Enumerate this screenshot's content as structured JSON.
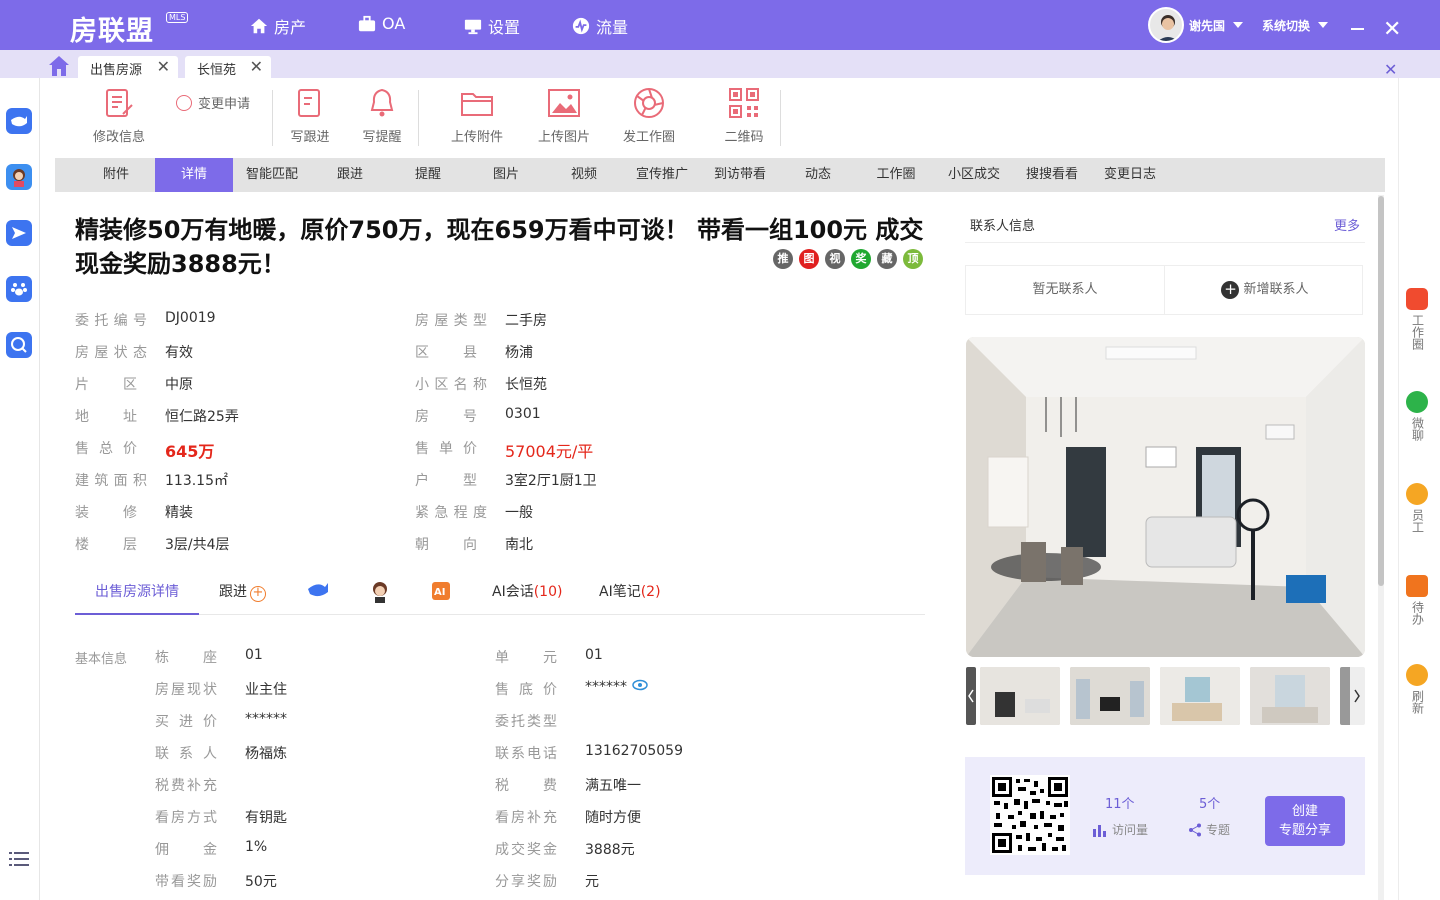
{
  "app": {
    "logo": "房联盟",
    "logo_badge": "MLS",
    "nav": [
      "房产",
      "OA",
      "设置",
      "流量"
    ],
    "user": "谢先国",
    "switch": "系统切换"
  },
  "tabs": [
    {
      "label": "出售房源"
    },
    {
      "label": "长恒苑"
    }
  ],
  "toolbar": {
    "edit": "修改信息",
    "change": "变更申请",
    "followup": "写跟进",
    "reminder": "写提醒",
    "attach": "上传附件",
    "image": "上传图片",
    "circle": "发工作圈",
    "qrcode": "二维码"
  },
  "subtabs": [
    "附件",
    "详情",
    "智能匹配",
    "跟进",
    "提醒",
    "图片",
    "视频",
    "宣传推广",
    "到访带看",
    "动态",
    "工作圈",
    "小区成交",
    "搜搜看看",
    "变更日志"
  ],
  "listing": {
    "title": "精装修50万有地暖，原价750万，现在659万看中可谈！ 带看一组100元 成交现金奖励3888元！",
    "badges": [
      "推",
      "图",
      "视",
      "奖",
      "藏",
      "顶"
    ]
  },
  "details_left": [
    {
      "k": "委托编号",
      "v": "DJ0019"
    },
    {
      "k": "房屋状态",
      "v": "有效"
    },
    {
      "k": "片区",
      "v": "中原"
    },
    {
      "k": "地址",
      "v": "恒仁路25弄"
    },
    {
      "k": "售总价",
      "v": "645万"
    },
    {
      "k": "建筑面积",
      "v": "113.15㎡"
    },
    {
      "k": "装修",
      "v": "精装"
    },
    {
      "k": "楼层",
      "v": "3层/共4层"
    }
  ],
  "details_right": [
    {
      "k": "房屋类型",
      "v": "二手房"
    },
    {
      "k": "区县",
      "v": "杨浦"
    },
    {
      "k": "小区名称",
      "v": "长恒苑"
    },
    {
      "k": "房号",
      "v": "0301"
    },
    {
      "k": "售单价",
      "v": "57004元/平"
    },
    {
      "k": "户型",
      "v": "3室2厅1厨1卫"
    },
    {
      "k": "紧急程度",
      "v": "一般"
    },
    {
      "k": "朝向",
      "v": "南北"
    }
  ],
  "section_nav": {
    "detail": "出售房源详情",
    "follow": "跟进",
    "ai_chat": "AI会话",
    "ai_chat_count": "(10)",
    "ai_note": "AI笔记",
    "ai_note_count": "(2)"
  },
  "basic": {
    "label": "基本信息",
    "left": [
      {
        "k": "栋座",
        "v": "01"
      },
      {
        "k": "房屋现状",
        "v": "业主住"
      },
      {
        "k": "买进价",
        "v": "******"
      },
      {
        "k": "联系人",
        "v": "杨福炼"
      },
      {
        "k": "税费补充",
        "v": ""
      },
      {
        "k": "看房方式",
        "v": "有钥匙"
      },
      {
        "k": "佣金",
        "v": "1%"
      },
      {
        "k": "带看奖励",
        "v": "50元"
      }
    ],
    "right": [
      {
        "k": "单元",
        "v": "01"
      },
      {
        "k": "售底价",
        "v": "******"
      },
      {
        "k": "委托类型",
        "v": ""
      },
      {
        "k": "联系电话",
        "v": "13162705059"
      },
      {
        "k": "税费",
        "v": "满五唯一"
      },
      {
        "k": "看房补充",
        "v": "随时方便"
      },
      {
        "k": "成交奖金",
        "v": "3888元"
      },
      {
        "k": "分享奖励",
        "v": "元"
      }
    ]
  },
  "contact": {
    "title": "联系人信息",
    "more": "更多",
    "none": "暂无联系人",
    "add": "新增联系人"
  },
  "share": {
    "visits": "11个",
    "visits_label": "访问量",
    "topics": "5个",
    "topics_label": "专题",
    "create": "创建",
    "create2": "专题分享"
  },
  "right_rail": [
    {
      "label": "工作圈",
      "color": "#f04b2f"
    },
    {
      "label": "微聊",
      "color": "#2db34a"
    },
    {
      "label": "员工",
      "color": "#f5a623"
    },
    {
      "label": "待办",
      "color": "#f0741e"
    },
    {
      "label": "刷新",
      "color": "#f5a623"
    }
  ],
  "colors": {
    "accent": "#7d6be9",
    "price": "#e4271b"
  }
}
